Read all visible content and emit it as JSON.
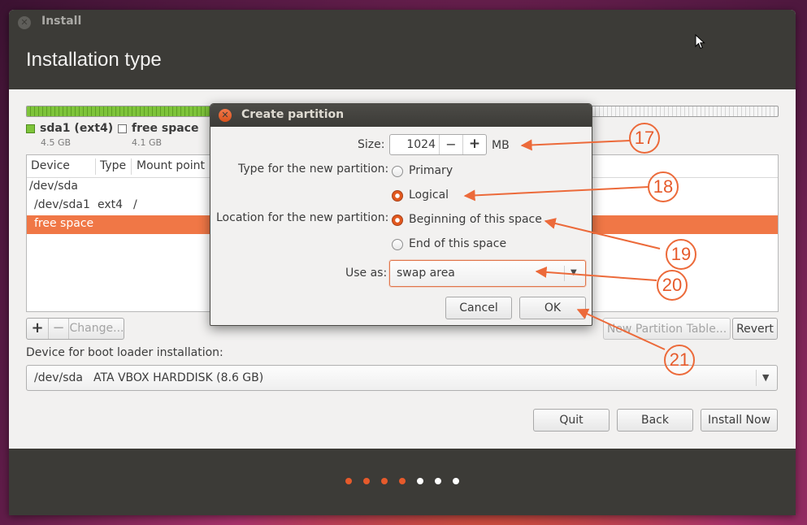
{
  "window": {
    "title": "Install",
    "page_heading": "Installation type"
  },
  "partition_bar": {
    "used_fraction": 0.245,
    "used_color": "#7ec43a",
    "free_color": "#ededed"
  },
  "legend": [
    {
      "name": "sda1 (ext4)",
      "size": "4.5 GB",
      "swatch_color": "#7ec43a"
    },
    {
      "name": "free space",
      "size": "4.1 GB",
      "swatch_color": "#ffffff"
    }
  ],
  "partition_table": {
    "columns": [
      "Device",
      "Type",
      "Mount point"
    ],
    "rows": [
      {
        "device": "/dev/sda",
        "type": "",
        "mount": ""
      },
      {
        "device": "/dev/sda1",
        "type": "ext4",
        "mount": "/"
      },
      {
        "device": "free space",
        "type": "",
        "mount": "",
        "selected": true
      }
    ]
  },
  "table_buttons": {
    "add": "+",
    "remove": "−",
    "change": "Change...",
    "new_table": "New Partition Table...",
    "revert": "Revert"
  },
  "boot_loader": {
    "label": "Device for boot loader installation:",
    "device": "/dev/sda",
    "description": "ATA VBOX HARDDISK (8.6 GB)"
  },
  "nav_buttons": {
    "quit": "Quit",
    "back": "Back",
    "install_now": "Install Now"
  },
  "progress_dots": {
    "total": 7,
    "completed": 4,
    "active_color": "#e65a2b",
    "inactive_color": "#ffffff"
  },
  "dialog": {
    "title": "Create partition",
    "size_label": "Size:",
    "size_value": "1024",
    "size_unit": "MB",
    "decrement": "−",
    "increment": "+",
    "type_label": "Type for the new partition:",
    "type_options": [
      {
        "label": "Primary",
        "selected": false
      },
      {
        "label": "Logical",
        "selected": true
      }
    ],
    "location_label": "Location for the new partition:",
    "location_options": [
      {
        "label": "Beginning of this space",
        "selected": true
      },
      {
        "label": "End of this space",
        "selected": false
      }
    ],
    "use_as_label": "Use as:",
    "use_as_value": "swap area",
    "cancel": "Cancel",
    "ok": "OK"
  },
  "annotations": [
    "17",
    "18",
    "19",
    "20",
    "21"
  ],
  "accent_color": "#f07746"
}
